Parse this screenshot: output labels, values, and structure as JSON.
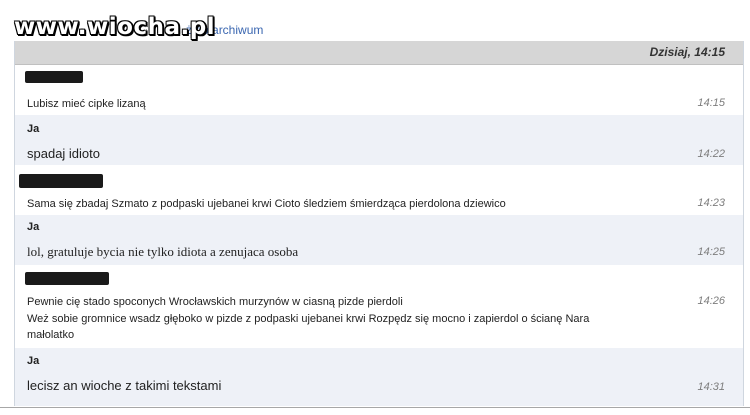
{
  "watermark": "www.wiocha.pl",
  "archive_link": "ż do archiwum",
  "date_header": "Dzisiaj, 14:15",
  "author_me": "Ja",
  "messages": [
    {
      "text": "Lubisz mieć cipke lizaną",
      "time": "14:15"
    },
    {
      "text": "spadaj idioto",
      "time": "14:22"
    },
    {
      "text": "Sama się zbadaj Szmato z podpaski ujebanei krwi Cioto śledziem śmierdząca pierdolona dziewico",
      "time": "14:23"
    },
    {
      "text": "lol, gratuluje bycia nie tylko idiota a zenujaca osoba",
      "time": "14:25"
    },
    {
      "line1": "Pewnie cię stado spoconych Wrocławskich murzynów w ciasną pizde pierdoli",
      "line2": "Weż sobie gromnice wsadz głęboko w pizde z podpaski ujebanei krwi Rozpędz się mocno i zapierdol o ścianę Nara",
      "line3": "małolatko",
      "time": "14:26"
    },
    {
      "text": "lecisz an wioche z takimi tekstami",
      "time": "14:31"
    }
  ]
}
